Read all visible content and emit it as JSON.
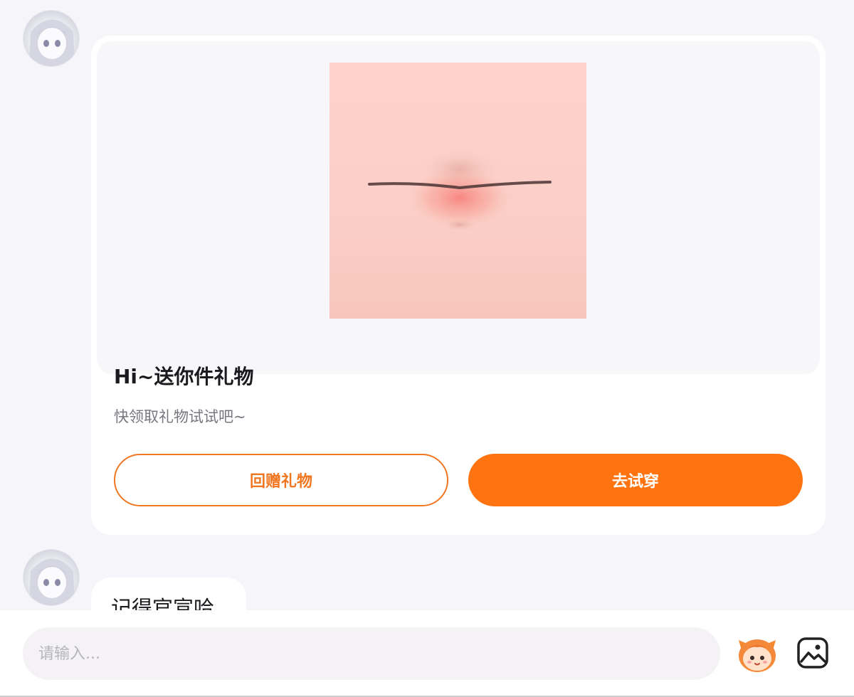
{
  "messages": {
    "gift_card": {
      "title": "Hi~送你件礼物",
      "subtitle": "快领取礼物试试吧~",
      "return_gift_label": "回赠礼物",
      "try_on_label": "去试穿",
      "image": "lips-makeup-gift"
    },
    "text_message": "记得官宣哈"
  },
  "composer": {
    "placeholder": "请输入...",
    "emoji_icon": "mascot-sticker-icon",
    "image_icon": "image-picker-icon"
  },
  "colors": {
    "accent": "#ff7411",
    "outline_accent": "#f07722",
    "background": "#f6f6fa"
  }
}
